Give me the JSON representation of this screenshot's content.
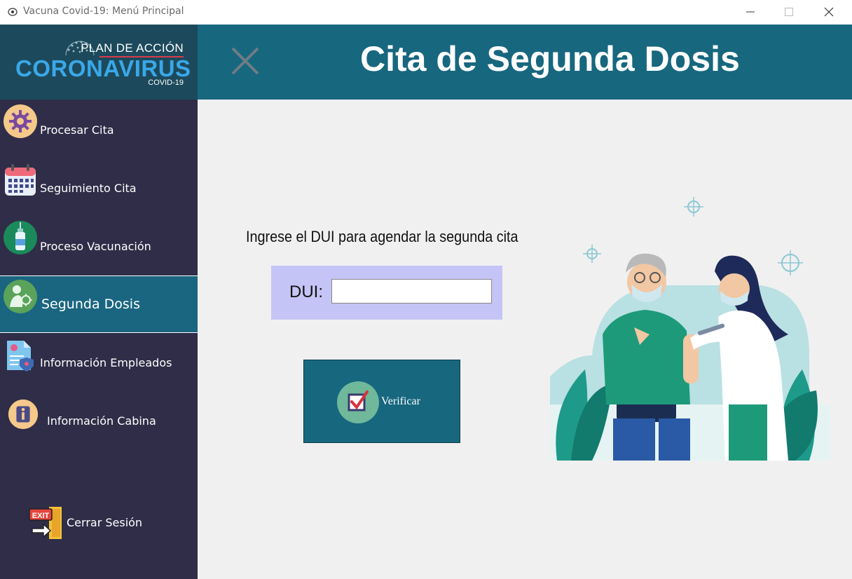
{
  "window": {
    "title": "Vacuna Covid-19: Menú Principal",
    "icons": [
      "app-icon",
      "minimize-icon",
      "maximize-icon",
      "close-icon"
    ]
  },
  "logo": {
    "plan": "PLAN DE ACCIÓN",
    "brand": "CORONAVIRUS",
    "sub": "COVID-19"
  },
  "sidebar": {
    "items": [
      {
        "label": "Procesar Cita",
        "icon": "gear-icon"
      },
      {
        "label": "Seguimiento Cita",
        "icon": "calendar-icon"
      },
      {
        "label": "Proceso Vacunación",
        "icon": "vaccine-vial-icon"
      },
      {
        "label": "Segunda Dosis",
        "icon": "person-virus-icon",
        "active": true
      },
      {
        "label": "Información Empleados",
        "icon": "employee-file-icon"
      },
      {
        "label": "Información Cabina",
        "icon": "info-icon"
      }
    ],
    "logout": {
      "label": "Cerrar Sesión",
      "icon": "exit-door-icon"
    }
  },
  "header": {
    "title": "Cita de Segunda Dosis",
    "close_icon": "close-x-icon"
  },
  "main": {
    "prompt": "Ingrese el DUI para agendar la segunda cita",
    "dui_label": "DUI:",
    "dui_value": "",
    "verify_label": "Verificar",
    "verify_icon": "checkbox-check-icon",
    "illustration": "vaccination-illustration"
  },
  "colors": {
    "sidebar": "#2f2d48",
    "header": "#17677f",
    "active": "#1a6680",
    "dui_box": "#c4c4f6",
    "logo_blue": "#3aa8e8"
  }
}
